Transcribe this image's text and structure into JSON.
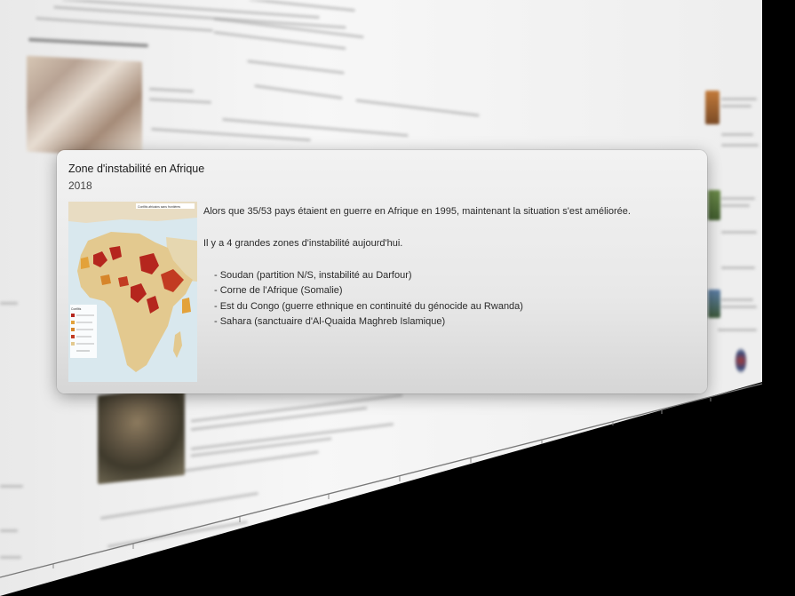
{
  "popup": {
    "title": "Zone d'instabilité en Afrique",
    "year": "2018",
    "paragraphs": [
      "Alors que 35/53 pays étaient en guerre en Afrique en 1995, maintenant la situation s'est améliorée.",
      "Il y a 4 grandes zones d'instabilité aujourd'hui."
    ],
    "zones": [
      "- Soudan (partition N/S, instabilité au Darfour)",
      "- Corne de l'Afrique (Somalie)",
      "- Est du Congo (guerre ethnique en continuité du génocide au Rwanda)",
      "- Sahara (sanctuaire d'Al-Quaida Maghreb Islamique)"
    ],
    "map": {
      "title": "Conflits africains sans frontières",
      "legend": "Conflits",
      "image_name": "africa-conflicts-map"
    }
  },
  "colors": {
    "card_bg": "#ececec",
    "map_land": "#e3c98f",
    "map_conflict": "#b5261e",
    "map_sea": "#d9e8ee",
    "outer_bg": "#000000"
  }
}
